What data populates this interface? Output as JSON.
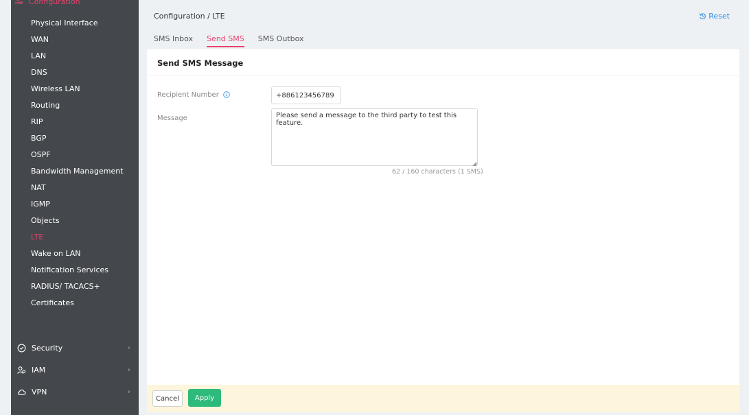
{
  "sidebar": {
    "section_title": "Configuration",
    "items": [
      {
        "label": "Physical Interface"
      },
      {
        "label": "WAN"
      },
      {
        "label": "LAN"
      },
      {
        "label": "DNS"
      },
      {
        "label": "Wireless LAN"
      },
      {
        "label": "Routing"
      },
      {
        "label": "RIP"
      },
      {
        "label": "BGP"
      },
      {
        "label": "OSPF"
      },
      {
        "label": "Bandwidth Management"
      },
      {
        "label": "NAT"
      },
      {
        "label": "IGMP"
      },
      {
        "label": "Objects"
      },
      {
        "label": "LTE",
        "active": true
      },
      {
        "label": "Wake on LAN"
      },
      {
        "label": "Notification Services"
      },
      {
        "label": "RADIUS/ TACACS+"
      },
      {
        "label": "Certificates"
      }
    ],
    "sections": [
      {
        "label": "Security",
        "icon": "shield-icon"
      },
      {
        "label": "IAM",
        "icon": "users-icon"
      },
      {
        "label": "VPN",
        "icon": "cloud-icon"
      }
    ]
  },
  "header": {
    "breadcrumb": "Configuration / LTE",
    "reset_label": "Reset"
  },
  "tabs": [
    {
      "label": "SMS Inbox"
    },
    {
      "label": "Send SMS",
      "active": true
    },
    {
      "label": "SMS Outbox"
    }
  ],
  "form": {
    "title": "Send SMS Message",
    "recipient_label": "Recipient Number",
    "recipient_value": "+886123456789",
    "message_label": "Message",
    "message_value": "Please send a message to the third party to test this feature.",
    "char_count": "62 / 160 characters (1 SMS)"
  },
  "footer": {
    "cancel_label": "Cancel",
    "apply_label": "Apply"
  },
  "colors": {
    "accent": "#e8426a",
    "link": "#3a8ee6",
    "apply": "#2dba7b",
    "sidebar_bg": "#44484d",
    "footer_bg": "#fdf6dc"
  }
}
